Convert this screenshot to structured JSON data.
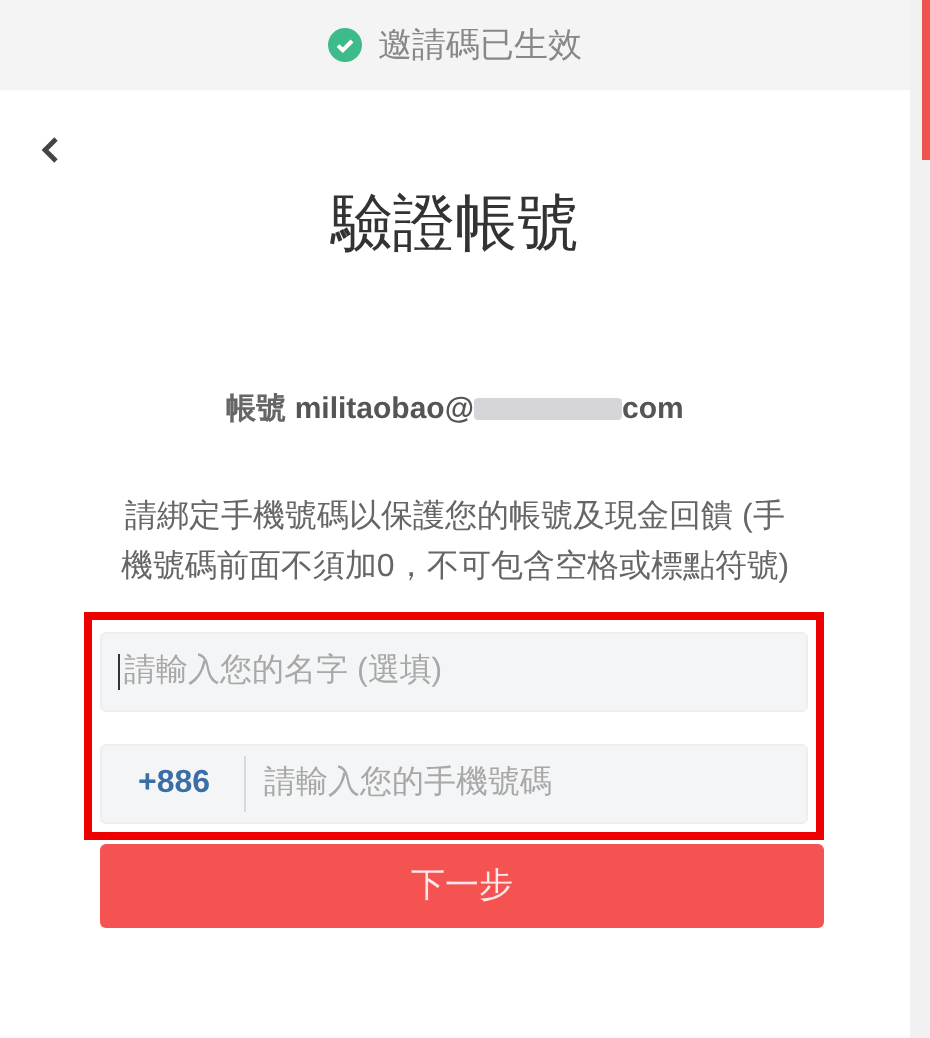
{
  "banner": {
    "text": "邀請碼已生效"
  },
  "header": {
    "title": "驗證帳號"
  },
  "account": {
    "label": "帳號",
    "email_start": "militaobao@",
    "email_end": "com"
  },
  "instructions": "請綁定手機號碼以保護您的帳號及現金回饋 (手機號碼前面不須加0，不可包含空格或標點符號)",
  "form": {
    "highlighted": true,
    "name_field": {
      "placeholder": "請輸入您的名字 (選填)",
      "focused": true
    },
    "phone_field": {
      "country_code": "+886",
      "placeholder": "請輸入您的手機號碼"
    }
  },
  "next_button": "下一步"
}
